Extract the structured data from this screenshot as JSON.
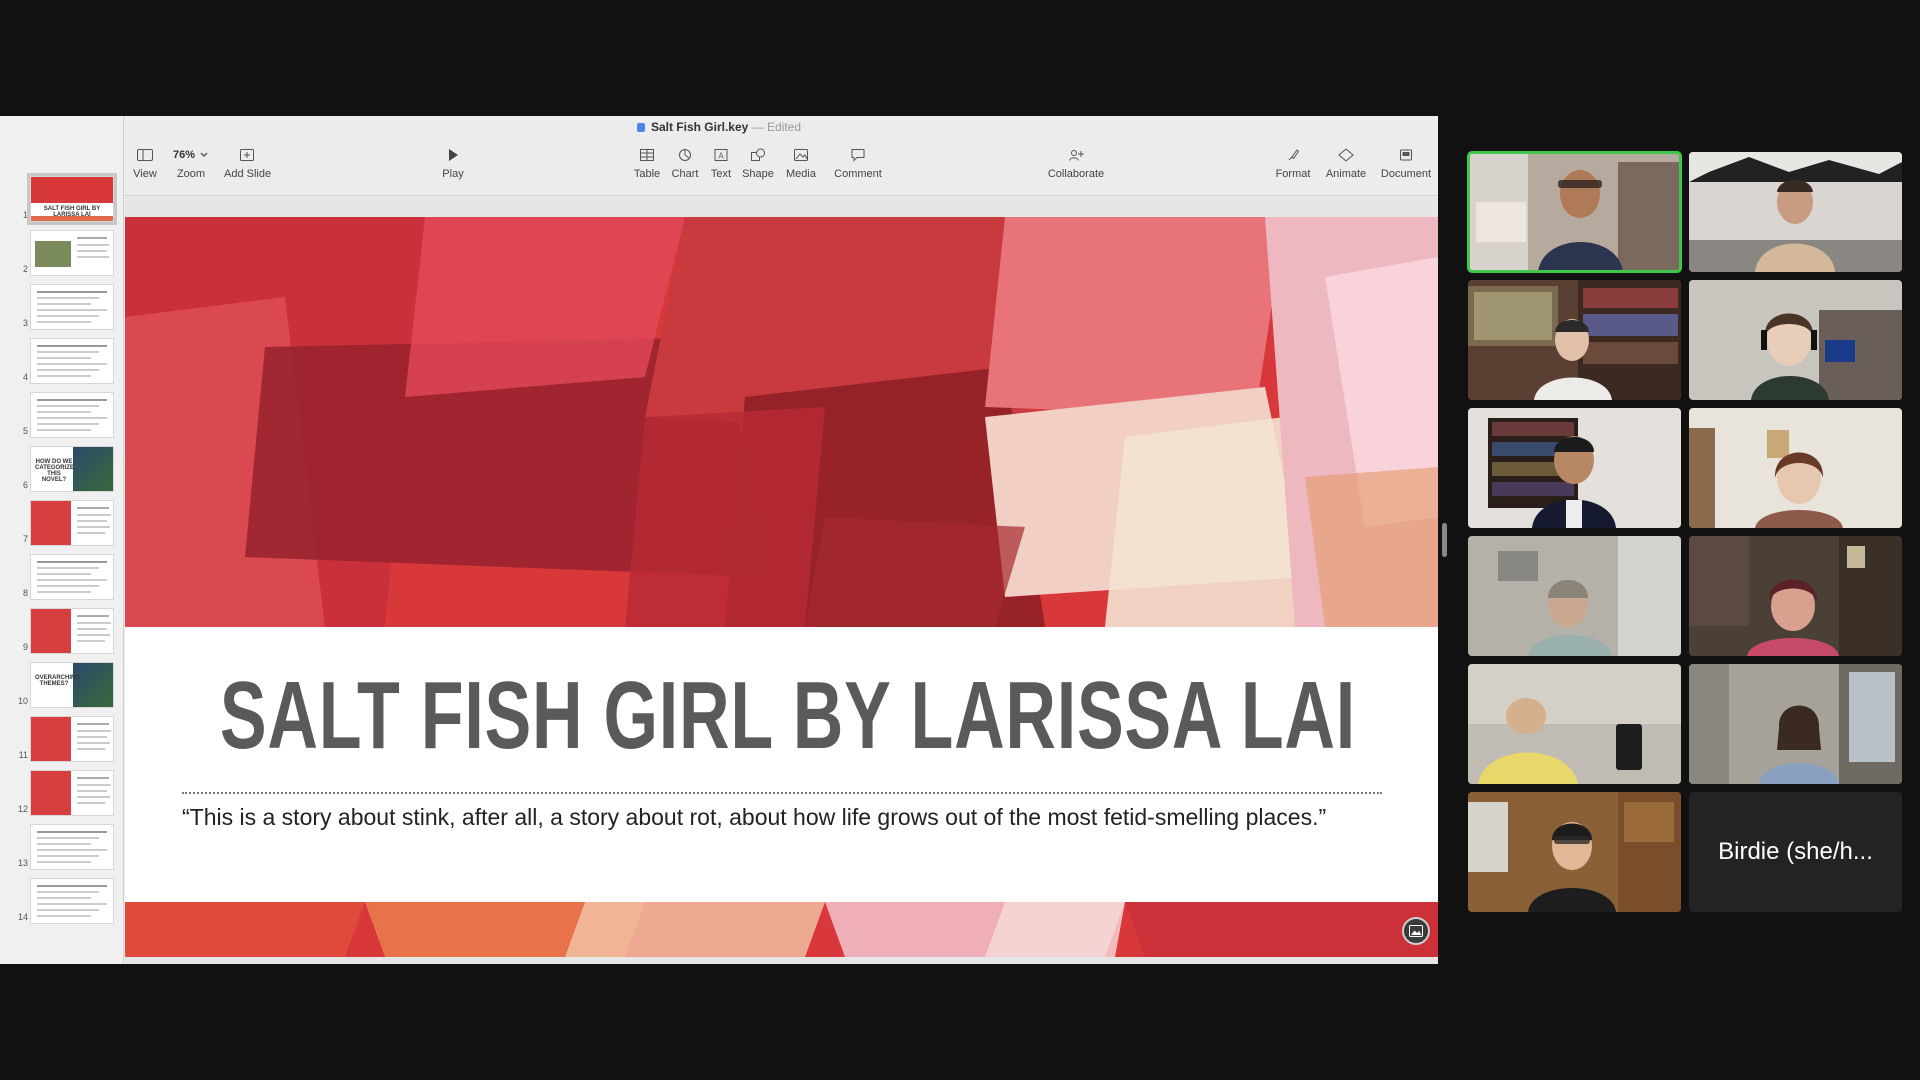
{
  "window": {
    "title": "Salt Fish Girl.key",
    "edited": "Edited"
  },
  "toolbar": {
    "view": "View",
    "zoom_value": "76%",
    "zoom": "Zoom",
    "add_slide": "Add Slide",
    "play": "Play",
    "table": "Table",
    "chart": "Chart",
    "text": "Text",
    "shape": "Shape",
    "media": "Media",
    "comment": "Comment",
    "collaborate": "Collaborate",
    "format": "Format",
    "animate": "Animate",
    "document": "Document"
  },
  "navigator": {
    "slides": [
      {
        "num": "1",
        "title": "SALT FISH GIRL BY LARISSA LAI"
      },
      {
        "num": "2",
        "title": ""
      },
      {
        "num": "3",
        "title": ""
      },
      {
        "num": "4",
        "title": ""
      },
      {
        "num": "5",
        "title": ""
      },
      {
        "num": "6",
        "title": "HOW DO WE CATEGORIZE THIS NOVEL?"
      },
      {
        "num": "7",
        "title": ""
      },
      {
        "num": "8",
        "title": ""
      },
      {
        "num": "9",
        "title": ""
      },
      {
        "num": "10",
        "title": "OVERARCHING THEMES?"
      },
      {
        "num": "11",
        "title": ""
      },
      {
        "num": "12",
        "title": ""
      },
      {
        "num": "13",
        "title": ""
      },
      {
        "num": "14",
        "title": ""
      }
    ],
    "selected": 1
  },
  "slide": {
    "title": "SALT FISH GIRL BY LARISSA LAI",
    "quote": "“This is a story about stink, after all, a story about rot, about how life grows out of the most fetid-smelling places.”"
  },
  "gallery": {
    "name_tile": "Birdie (she/h..."
  },
  "colors": {
    "active_speaker": "#3fc74c",
    "slide_title": "#5a5a5a",
    "art_red": "#d8383a"
  }
}
